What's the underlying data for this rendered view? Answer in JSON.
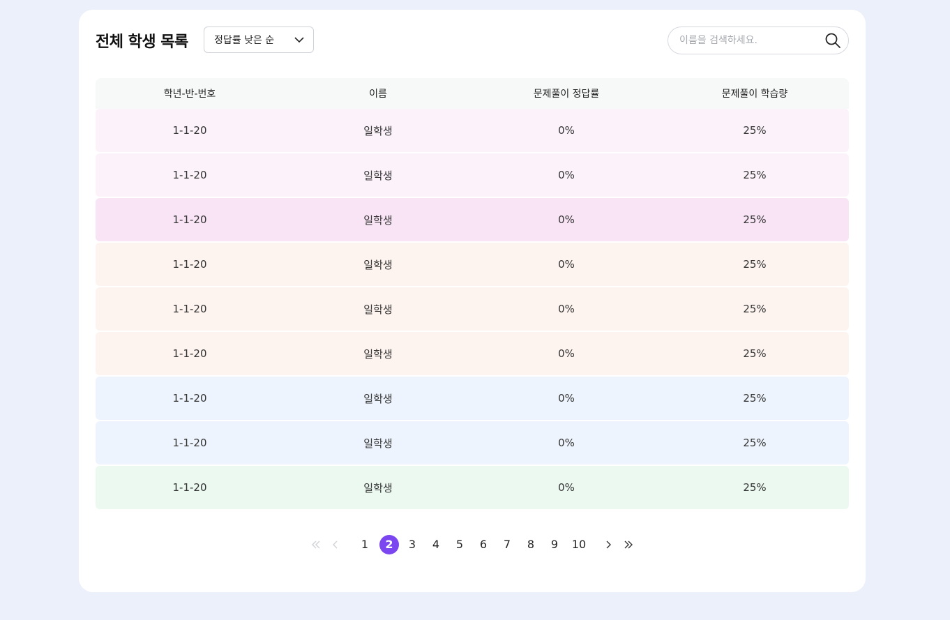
{
  "header": {
    "title": "전체 학생 목록",
    "sort_selected": "정답률 낮은 순",
    "search_placeholder": "이름을 검색하세요."
  },
  "table": {
    "columns": [
      "학년-반-번호",
      "이름",
      "문제풀이 정답률",
      "문제풀이 학습량"
    ],
    "rows": [
      {
        "id": "1-1-20",
        "name": "일학생",
        "accuracy": "0%",
        "volume": "25%",
        "bg": "#fcf2fa"
      },
      {
        "id": "1-1-20",
        "name": "일학생",
        "accuracy": "0%",
        "volume": "25%",
        "bg": "#fcf2fa"
      },
      {
        "id": "1-1-20",
        "name": "일학생",
        "accuracy": "0%",
        "volume": "25%",
        "bg": "#f9e4f6"
      },
      {
        "id": "1-1-20",
        "name": "일학생",
        "accuracy": "0%",
        "volume": "25%",
        "bg": "#fdf3ef"
      },
      {
        "id": "1-1-20",
        "name": "일학생",
        "accuracy": "0%",
        "volume": "25%",
        "bg": "#fdf3ef"
      },
      {
        "id": "1-1-20",
        "name": "일학생",
        "accuracy": "0%",
        "volume": "25%",
        "bg": "#fdf3ef"
      },
      {
        "id": "1-1-20",
        "name": "일학생",
        "accuracy": "0%",
        "volume": "25%",
        "bg": "#eef4fd"
      },
      {
        "id": "1-1-20",
        "name": "일학생",
        "accuracy": "0%",
        "volume": "25%",
        "bg": "#eef4fd"
      },
      {
        "id": "1-1-20",
        "name": "일학생",
        "accuracy": "0%",
        "volume": "25%",
        "bg": "#ebf9f0"
      }
    ]
  },
  "pagination": {
    "pages": [
      "1",
      "2",
      "3",
      "4",
      "5",
      "6",
      "7",
      "8",
      "9",
      "10"
    ],
    "current": "2",
    "nav_icons": [
      "double-chevron-left-icon",
      "chevron-left-icon",
      "chevron-right-icon",
      "double-chevron-right-icon"
    ]
  },
  "colors": {
    "accent": "#7b45f0",
    "page_background": "#ecf0fb",
    "header_row": "#f7f8f8"
  }
}
